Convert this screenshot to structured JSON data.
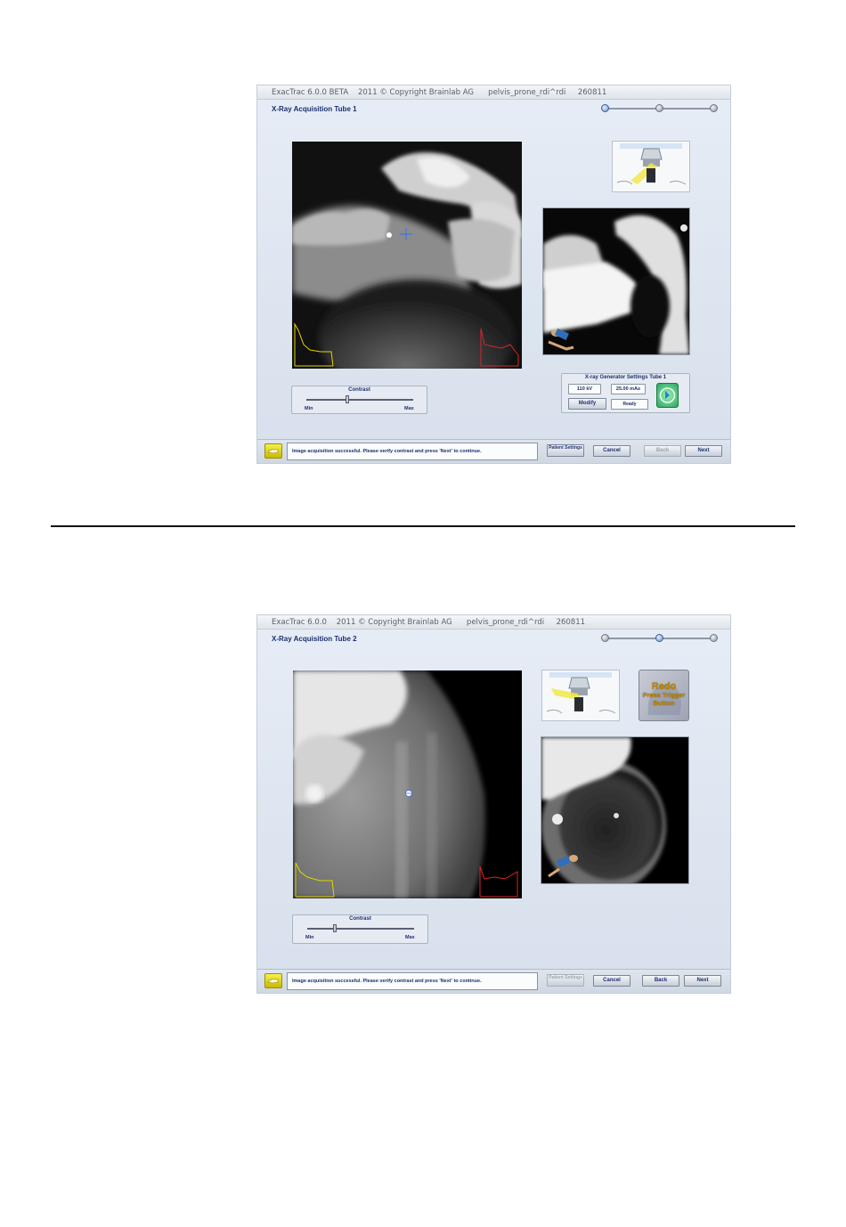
{
  "screens": [
    {
      "title_bar": "ExacTrac 6.0.0 BETA    2011 © Copyright Brainlab AG      pelvis_prone_rdi^rdi     260811",
      "page_title": "X-Ray Acquisition Tube 1",
      "progress_step": 1,
      "progress_steps_total": 3,
      "contrast": {
        "label": "Contrast",
        "min_label": "Min",
        "max_label": "Max",
        "value_fraction": 0.37
      },
      "generator": {
        "title": "X-ray Generator Settings Tube 1",
        "kv": "110 kV",
        "mas": "25.00 mAs",
        "modify_label": "Modify",
        "status_label": "Ready"
      },
      "status_message": "Image acquisition successful. Please verify contrast and press 'Next' to continue.",
      "buttons": {
        "patient_settings": "Patient Settings",
        "cancel": "Cancel",
        "back": "Back",
        "next": "Next"
      },
      "back_enabled": false
    },
    {
      "title_bar": "ExacTrac 6.0.0    2011 © Copyright Brainlab AG      pelvis_prone_rdi^rdi     260811",
      "page_title": "X-Ray Acquisition Tube 2",
      "progress_step": 2,
      "progress_steps_total": 3,
      "contrast": {
        "label": "Contrast",
        "min_label": "Min",
        "max_label": "Max",
        "value_fraction": 0.25
      },
      "redo": {
        "line1": "Redo",
        "line2": "Press Trigger",
        "line3": "Button"
      },
      "status_message": "Image acquisition successful. Please verify contrast and press 'Next' to continue.",
      "buttons": {
        "patient_settings": "Patient Settings",
        "cancel": "Cancel",
        "back": "Back",
        "next": "Next"
      },
      "patient_settings_enabled": false
    }
  ],
  "colors": {
    "title_text": "#1b2f6e",
    "histogram_left": "#e0d600",
    "histogram_right": "#d8262a",
    "crosshair": "#3d6cf0"
  }
}
